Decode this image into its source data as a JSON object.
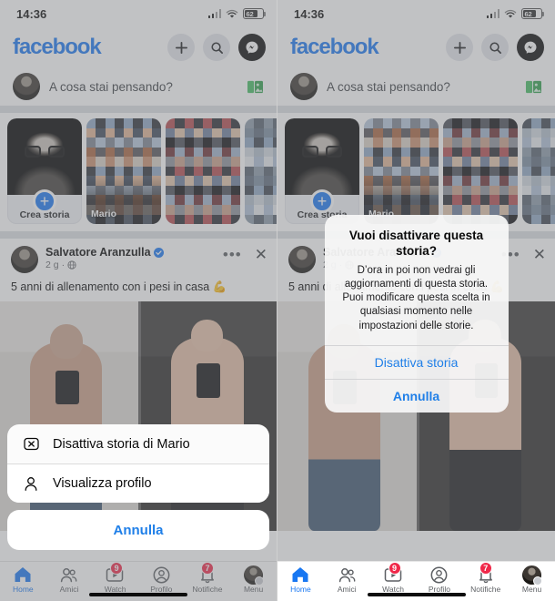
{
  "status_bar": {
    "time": "14:36",
    "battery_level": "62"
  },
  "header": {
    "logo": "facebook",
    "icons": [
      {
        "name": "plus-icon",
        "label": "Crea"
      },
      {
        "name": "search-icon",
        "label": "Cerca"
      },
      {
        "name": "messenger-icon",
        "label": "Messenger"
      }
    ]
  },
  "composer": {
    "placeholder": "A cosa stai pensando?",
    "photo_icon": "gallery-icon"
  },
  "stories": {
    "create": {
      "label": "Crea storia"
    },
    "items": [
      {
        "name": "Mario"
      },
      {
        "name": ""
      },
      {
        "name": ""
      }
    ]
  },
  "post": {
    "author": "Salvatore Aranzulla",
    "verified": true,
    "time": "2 g",
    "privacy_icon": "globe-icon",
    "more_icon": "more-dots-icon",
    "close_icon": "close-icon",
    "text": "5 anni di allenamento con i pesi in casa 💪"
  },
  "action_sheet": {
    "items": [
      {
        "label": "Disattiva storia di Mario",
        "icon": "mute-box-icon"
      },
      {
        "label": "Visualizza profilo",
        "icon": "person-icon"
      }
    ],
    "cancel": "Annulla"
  },
  "alert": {
    "title": "Vuoi disattivare questa storia?",
    "message": "D’ora in poi non vedrai gli aggiornamenti di questa storia. Puoi modificare questa scelta in qualsiasi momento nelle impostazioni delle storie.",
    "confirm": "Disattiva storia",
    "cancel": "Annulla"
  },
  "bottom_nav": {
    "items": [
      {
        "label": "Home",
        "icon": "home-icon",
        "badge": "",
        "active": true
      },
      {
        "label": "Amici",
        "icon": "friends-icon",
        "badge": "",
        "active": false
      },
      {
        "label": "Watch",
        "icon": "watch-icon",
        "badge": "9",
        "active": false
      },
      {
        "label": "Profilo",
        "icon": "profile-icon",
        "badge": "",
        "active": false
      },
      {
        "label": "Notifiche",
        "icon": "bell-icon",
        "badge": "7",
        "active": false
      },
      {
        "label": "Menu",
        "icon": "menu-avatar-icon",
        "badge": "",
        "active": false
      }
    ]
  },
  "colors": {
    "brand": "#1877f2",
    "badge": "#f02849",
    "link": "#1f7fe8"
  }
}
